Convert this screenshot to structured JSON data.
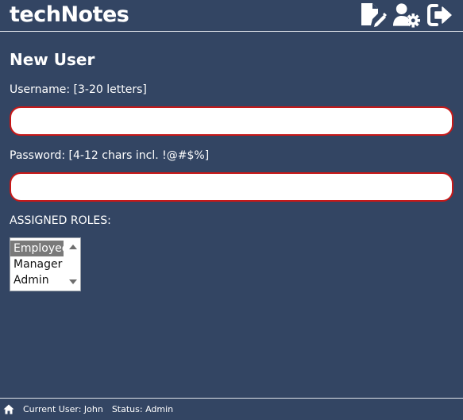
{
  "header": {
    "title": "techNotes",
    "icons": [
      "new-note-icon",
      "user-settings-icon",
      "logout-icon"
    ]
  },
  "main": {
    "page_title": "New User",
    "username_label": "Username: [3-20 letters]",
    "username_value": "",
    "password_label": "Password: [4-12 chars incl. !@#$%]",
    "password_value": "",
    "roles_label": "ASSIGNED ROLES:",
    "roles_options": [
      "Employee",
      "Manager",
      "Admin"
    ],
    "roles_selected": "Employee"
  },
  "footer": {
    "current_user": "Current User: John",
    "status": "Status: Admin"
  },
  "colors": {
    "background": "#334563",
    "text": "#ffffff",
    "input_border_invalid": "#c81818"
  }
}
